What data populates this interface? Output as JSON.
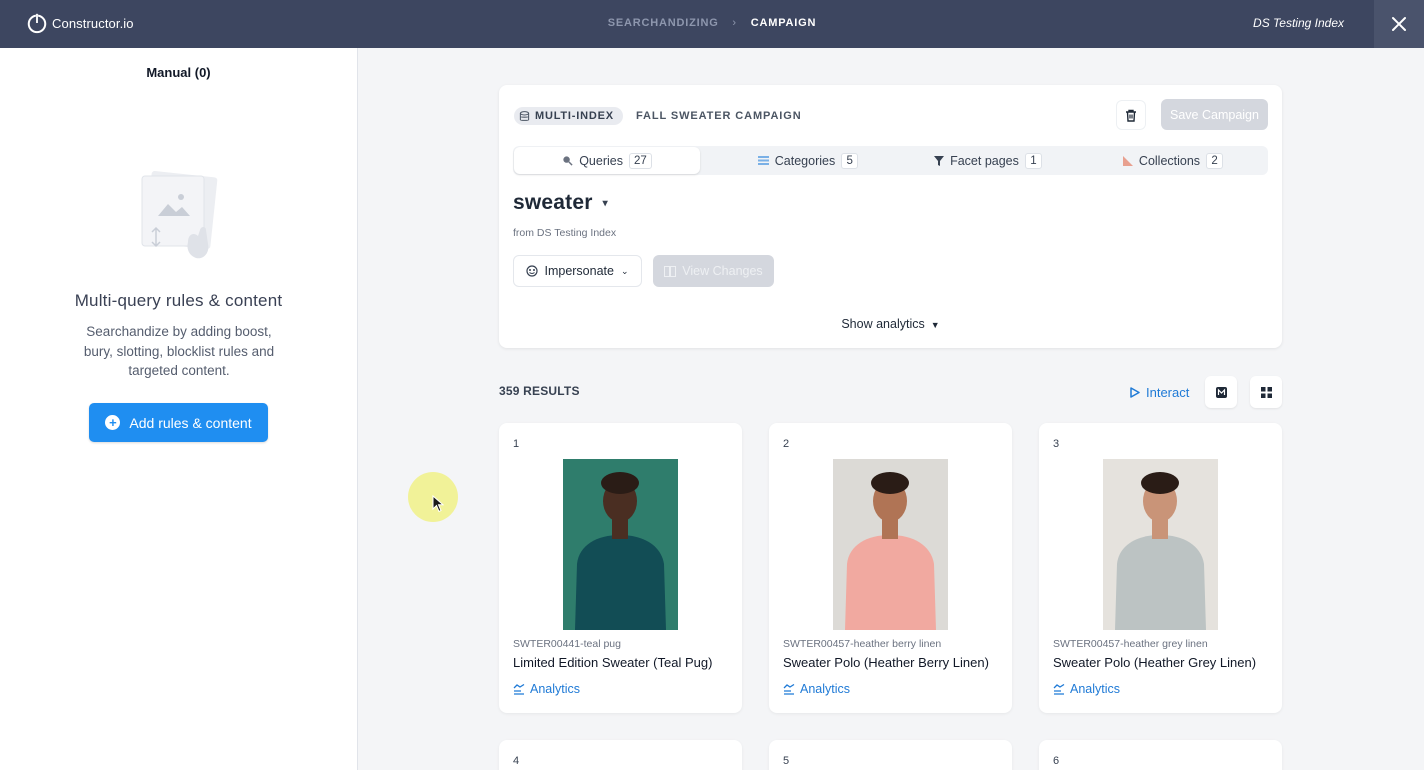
{
  "topbar": {
    "brand": "Constructor.io",
    "breadcrumb": [
      "SEARCHANDIZING",
      "CAMPAIGN"
    ],
    "index_name": "DS Testing Index"
  },
  "left_panel": {
    "manual_label": "Manual (0)",
    "empty_title": "Multi-query rules & content",
    "empty_desc": "Searchandize by adding boost, bury, slotting, blocklist rules and targeted content.",
    "add_button": "Add rules & content"
  },
  "campaign": {
    "badge": "MULTI-INDEX",
    "name": "FALL SWEATER CAMPAIGN",
    "save_label": "Save Campaign",
    "tabs": [
      {
        "label": "Queries",
        "count": "27",
        "icon": "search-icon",
        "active": true
      },
      {
        "label": "Categories",
        "count": "5",
        "icon": "list-icon"
      },
      {
        "label": "Facet pages",
        "count": "1",
        "icon": "filter-icon"
      },
      {
        "label": "Collections",
        "count": "2",
        "icon": "collection-icon"
      }
    ],
    "query": "sweater",
    "query_source": "from DS Testing Index",
    "impersonate_label": "Impersonate",
    "view_changes_label": "View Changes",
    "show_analytics_label": "Show analytics"
  },
  "results": {
    "count_label": "359 RESULTS",
    "interact_label": "Interact",
    "products": [
      {
        "rank": "1",
        "sku": "SWTER00441-teal pug",
        "name": "Limited Edition Sweater (Teal Pug)",
        "analytics": "Analytics",
        "bg": "#2f7d6c",
        "shirt": "#124d55",
        "skin": "#4a2e22"
      },
      {
        "rank": "2",
        "sku": "SWTER00457-heather berry linen",
        "name": "Sweater Polo (Heather Berry Linen)",
        "analytics": "Analytics",
        "bg": "#dcdad6",
        "shirt": "#f1a9a0",
        "skin": "#b07455"
      },
      {
        "rank": "3",
        "sku": "SWTER00457-heather grey linen",
        "name": "Sweater Polo (Heather Grey Linen)",
        "analytics": "Analytics",
        "bg": "#e5e2dd",
        "shirt": "#bcc3c3",
        "skin": "#c99478"
      },
      {
        "rank": "4"
      },
      {
        "rank": "5"
      },
      {
        "rank": "6"
      }
    ]
  },
  "colors": {
    "topbar": "#3d4660",
    "primary": "#1f8ef1",
    "link": "#1f7ad6"
  }
}
